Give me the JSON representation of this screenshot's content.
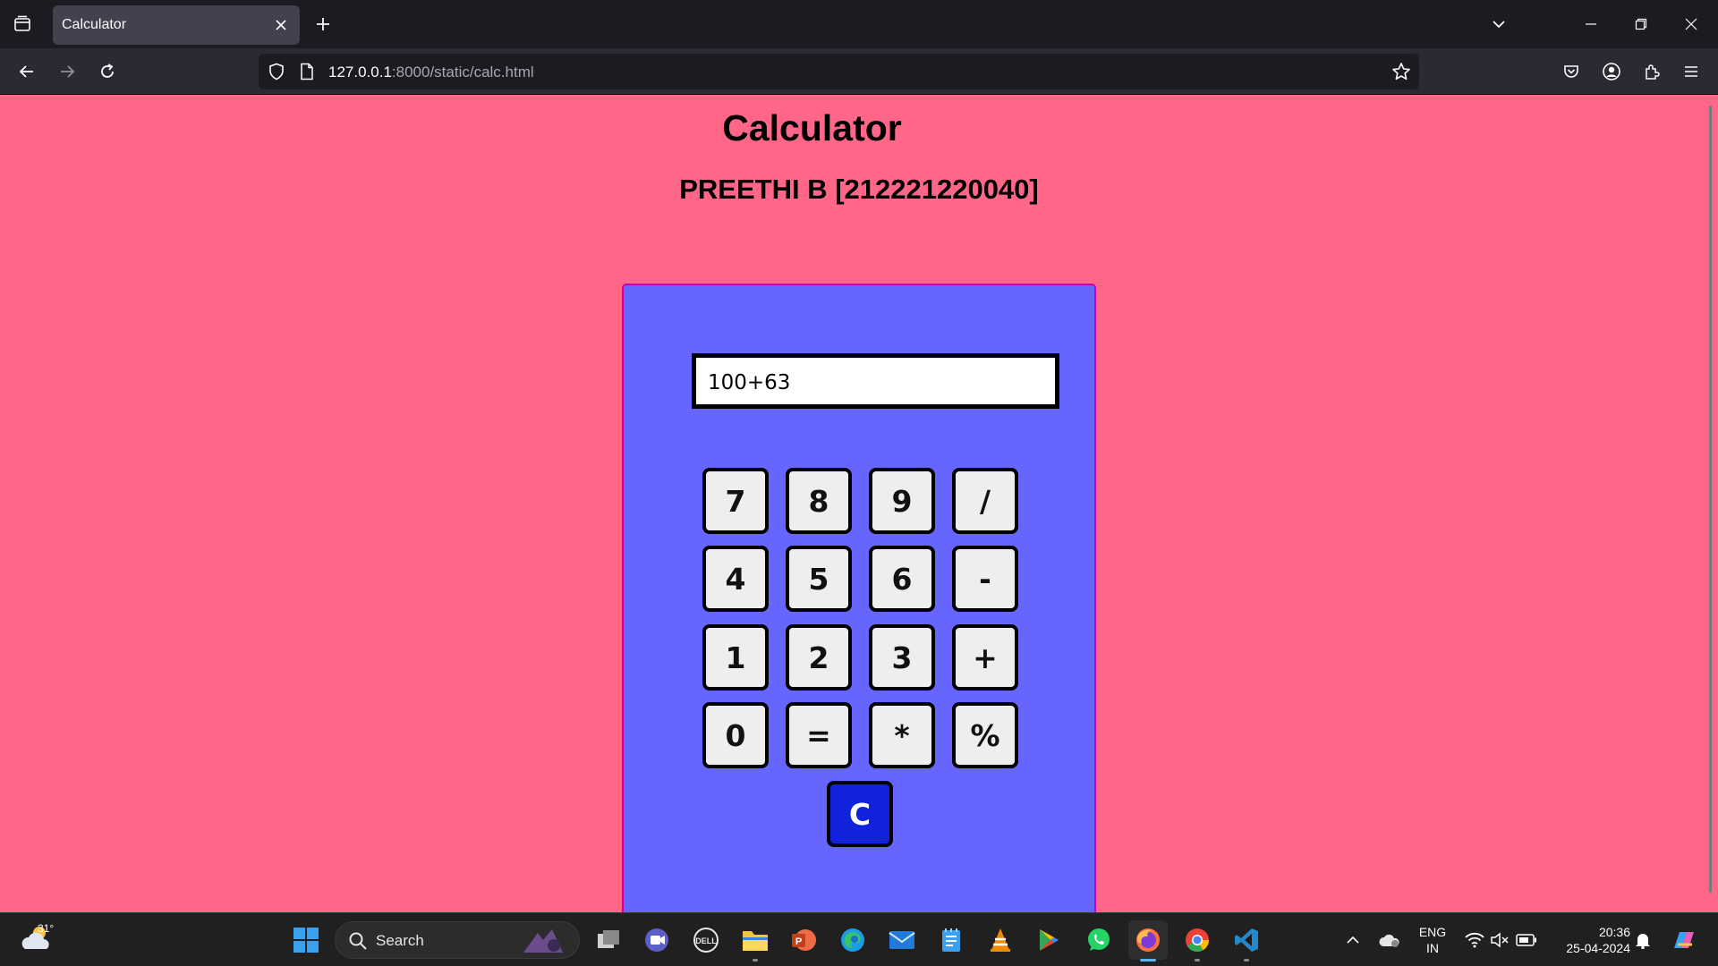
{
  "browser": {
    "tab_title": "Calculator",
    "url_host": "127.0.0.1",
    "url_path": ":8000/static/calc.html"
  },
  "page": {
    "title": "Calculator",
    "subtitle": "PREETHI B [212221220040]"
  },
  "calculator": {
    "display_value": "100+63",
    "keys": {
      "k7": "7",
      "k8": "8",
      "k9": "9",
      "kdiv": "/",
      "k4": "4",
      "k5": "5",
      "k6": "6",
      "ksub": "-",
      "k1": "1",
      "k2": "2",
      "k3": "3",
      "kadd": "+",
      "k0": "0",
      "keq": "=",
      "kmul": "*",
      "kmod": "%",
      "kclear": "C"
    }
  },
  "taskbar": {
    "weather_temp": "31°",
    "search_label": "Search",
    "language_line1": "ENG",
    "language_line2": "IN",
    "time": "20:36",
    "date": "25-04-2024",
    "apps": [
      "windows-start",
      "task-view",
      "teams-chat",
      "dell",
      "file-explorer",
      "powerpoint",
      "edge",
      "mail",
      "notepad",
      "vlc",
      "play-store",
      "whatsapp",
      "firefox",
      "chrome",
      "vscode"
    ]
  },
  "colors": {
    "page_background": "#ff6688",
    "calculator_background": "#6666ff",
    "calculator_border": "#d400aa",
    "clear_key": "#1122dd",
    "key_background": "#eeeeee"
  }
}
